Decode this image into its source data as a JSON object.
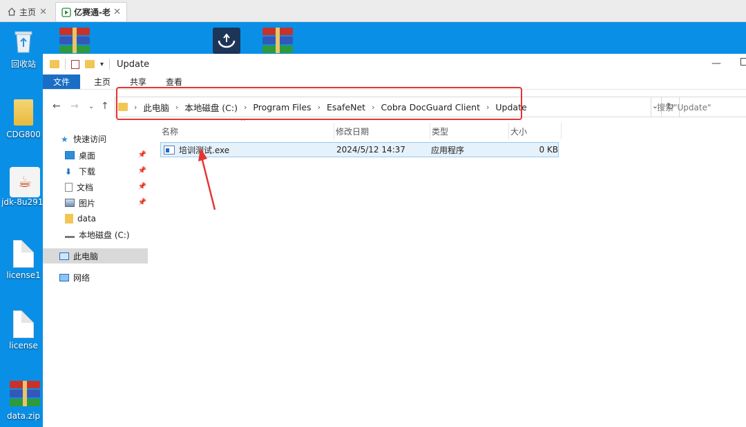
{
  "viewer_tabs": [
    {
      "label": "主页"
    },
    {
      "label": "亿赛通-老"
    }
  ],
  "desktop_icons": [
    {
      "label": "回收站"
    },
    {
      "label": "CDG800"
    },
    {
      "label": "jdk-8u291-"
    },
    {
      "label": "license1"
    },
    {
      "label": "license"
    },
    {
      "label": "data.zip"
    }
  ],
  "explorer": {
    "title": "Update",
    "ribbon_tabs": [
      "文件",
      "主页",
      "共享",
      "查看"
    ],
    "breadcrumb": [
      "此电脑",
      "本地磁盘 (C:)",
      "Program Files",
      "EsafeNet",
      "Cobra DocGuard Client",
      "Update"
    ],
    "search_placeholder": "搜索\"Update\"",
    "nav": {
      "quick_access": "快速访问",
      "items": [
        {
          "label": "桌面",
          "pinned": true
        },
        {
          "label": "下载",
          "pinned": true
        },
        {
          "label": "文档",
          "pinned": true
        },
        {
          "label": "图片",
          "pinned": true
        },
        {
          "label": "data",
          "pinned": false
        },
        {
          "label": "本地磁盘 (C:)",
          "pinned": false
        }
      ],
      "this_pc": "此电脑",
      "network": "网络"
    },
    "columns": [
      "名称",
      "修改日期",
      "类型",
      "大小"
    ],
    "files": [
      {
        "name": "培训测试.exe",
        "modified": "2024/5/12 14:37",
        "type": "应用程序",
        "size": "0 KB"
      }
    ]
  },
  "colors": {
    "desktop": "#0a8fe6",
    "accent": "#1a6ec6",
    "annotation": "#e53333"
  }
}
